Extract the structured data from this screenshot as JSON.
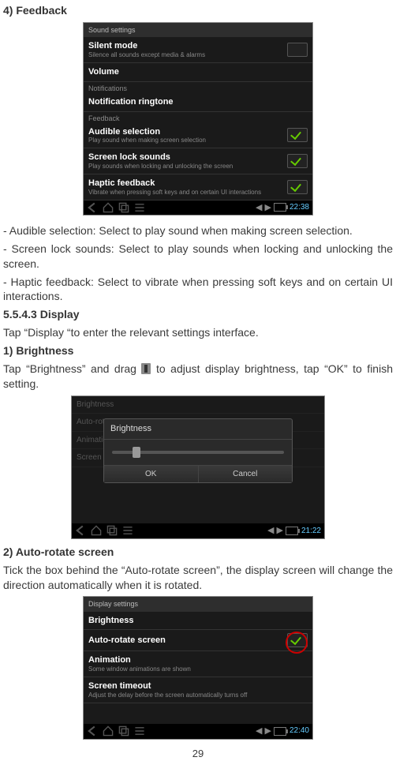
{
  "h_feedback": "4) Feedback",
  "p_audible": "- Audible selection: Select to play sound when making screen selection.",
  "p_lock": "- Screen lock sounds: Select to play sounds when locking and unlocking the screen.",
  "p_haptic": "- Haptic feedback: Select to vibrate when pressing soft keys and on certain UI interactions.",
  "h_display": "5.5.4.3 Display",
  "p_tapdisplay": "Tap “Display “to enter the relevant settings interface.",
  "h_brightness": "1) Brightness",
  "p_bright_pre": "Tap “Brightness” and drag ",
  "p_bright_post": " to adjust display brightness, tap “OK” to finish setting.",
  "h_autorotate": "2) Auto-rotate screen",
  "p_autorotate": "Tick the box behind the “Auto-rotate screen”, the display screen will change the direction automatically when it is rotated.",
  "page_number": "29",
  "shot1": {
    "title": "Sound settings",
    "row0t1": "Silent mode",
    "row0t2": "Silence all sounds except media & alarms",
    "row1t1": "Volume",
    "sec1": "Notifications",
    "row2t1": "Notification ringtone",
    "sec2": "Feedback",
    "row3t1": "Audible selection",
    "row3t2": "Play sound when making screen selection",
    "row4t1": "Screen lock sounds",
    "row4t2": "Play sounds when locking and unlocking the screen",
    "row5t1": "Haptic feedback",
    "row5t2": "Vibrate when pressing soft keys and on certain UI interactions",
    "clock": "22:38"
  },
  "shot2": {
    "dim0": "Brightness",
    "dim1": "Auto-rotate screen",
    "dim2": "Animation",
    "dim3": "Screen timeout",
    "modal_title": "Brightness",
    "ok": "OK",
    "cancel": "Cancel",
    "clock": "21:22"
  },
  "shot3": {
    "title": "Display settings",
    "r0t1": "Brightness",
    "r1t1": "Auto-rotate screen",
    "r2t1": "Animation",
    "r2t2": "Some window animations are shown",
    "r3t1": "Screen timeout",
    "r3t2": "Adjust the delay before the screen automatically turns off",
    "clock": "22:40"
  }
}
